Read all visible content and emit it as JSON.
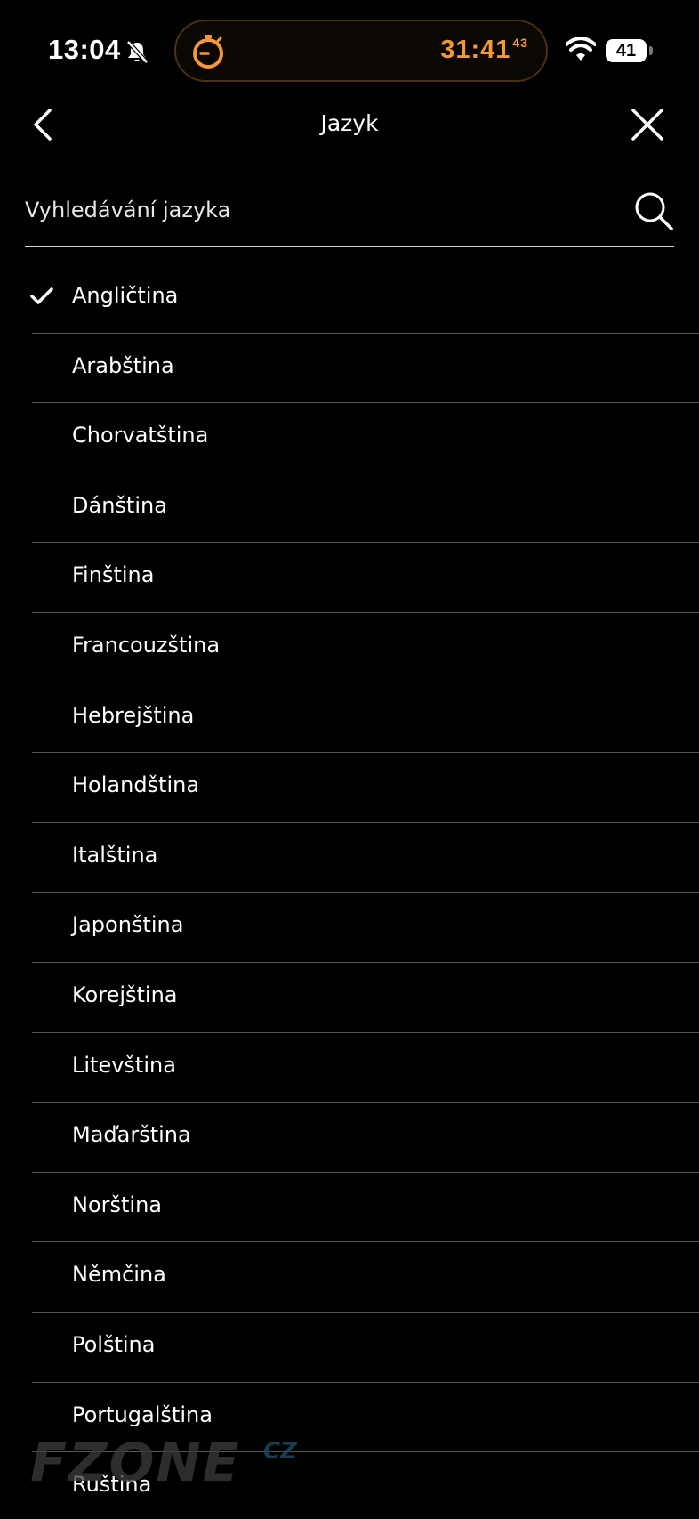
{
  "status_bar": {
    "time": "13:04",
    "timer_main": "31:41",
    "timer_fraction": "43",
    "battery": "41",
    "accent_color": "#f2993a"
  },
  "nav": {
    "title": "Jazyk",
    "back_icon": "chevron-left-icon",
    "close_icon": "close-icon"
  },
  "search": {
    "placeholder": "Vyhledávání jazyka",
    "value": ""
  },
  "languages": [
    {
      "label": "Angličtina",
      "selected": true
    },
    {
      "label": "Arabština",
      "selected": false
    },
    {
      "label": "Chorvatština",
      "selected": false
    },
    {
      "label": "Dánština",
      "selected": false
    },
    {
      "label": "Finština",
      "selected": false
    },
    {
      "label": "Francouzština",
      "selected": false
    },
    {
      "label": "Hebrejština",
      "selected": false
    },
    {
      "label": "Holandština",
      "selected": false
    },
    {
      "label": "Italština",
      "selected": false
    },
    {
      "label": "Japonština",
      "selected": false
    },
    {
      "label": "Korejština",
      "selected": false
    },
    {
      "label": "Litevština",
      "selected": false
    },
    {
      "label": "Maďarština",
      "selected": false
    },
    {
      "label": "Norština",
      "selected": false
    },
    {
      "label": "Němčina",
      "selected": false
    },
    {
      "label": "Polština",
      "selected": false
    },
    {
      "label": "Portugalština",
      "selected": false
    },
    {
      "label": "Ruština",
      "selected": false
    }
  ],
  "watermark": {
    "main": "FZONE",
    "suffix": "CZ"
  }
}
